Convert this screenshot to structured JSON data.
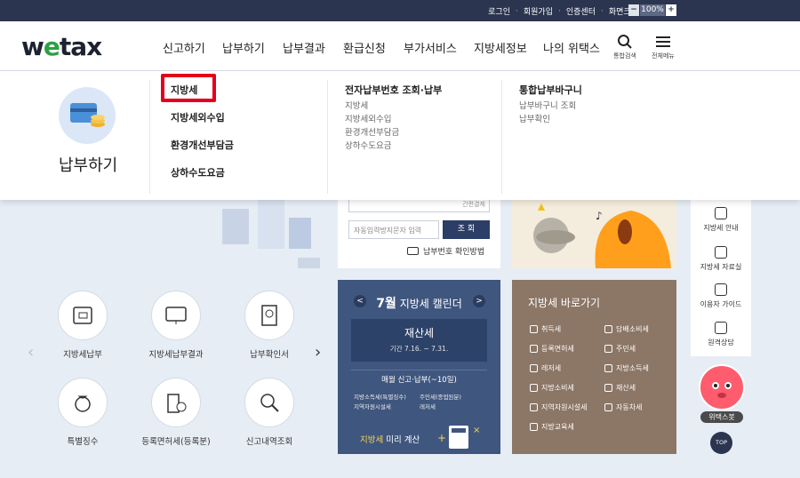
{
  "topbar": {
    "links": [
      "로그인",
      "회원가입",
      "인증센터",
      "화면크기"
    ],
    "zoom_minus": "−",
    "zoom_value": "100%",
    "zoom_plus": "+"
  },
  "header": {
    "logo": "wetax",
    "nav": [
      "신고하기",
      "납부하기",
      "납부결과",
      "환급신청",
      "부가서비스",
      "지방세정보",
      "나의 위택스"
    ],
    "search_label": "통합검색",
    "menu_label": "전체메뉴"
  },
  "mega": {
    "title": "납부하기",
    "col1": [
      "지방세",
      "지방세외수입",
      "환경개선부담금",
      "상하수도요금"
    ],
    "col2": {
      "head": "전자납부번호 조회·납부",
      "items": [
        "지방세",
        "지방세외수입",
        "환경개선부담금",
        "상하수도요금"
      ]
    },
    "col3": {
      "head": "통합납부바구니",
      "items": [
        "납부바구니 조회",
        "납부확인"
      ]
    }
  },
  "services": [
    {
      "label": "지방세납부"
    },
    {
      "label": "지방세납부결과"
    },
    {
      "label": "납부확인서"
    },
    {
      "label": "특별징수"
    },
    {
      "label": "등록면허세(등록분)"
    },
    {
      "label": "신고내역조회"
    }
  ],
  "pay": {
    "partial_btn": "간편결제",
    "placeholder": "자동입력방지문자 입력",
    "query_btn": "조 회",
    "help": "납부번호 확인방법"
  },
  "calendar": {
    "month": "7월",
    "title": "지방세 캘린더",
    "tax": "재산세",
    "period": "기간 7.16. ~ 7.31.",
    "monthly": "매월 신고·납부(~10일)",
    "items": [
      "지방소득세(특별징수)",
      "주민세(종업원분)",
      "지역자원시설세",
      "레저세"
    ],
    "precalc_hl": "지방세",
    "precalc_rest": " 미리 계산"
  },
  "shortcut": {
    "title": "지방세 바로가기",
    "items": [
      "취득세",
      "담배소비세",
      "등록면허세",
      "주민세",
      "레저세",
      "지방소득세",
      "지방소비세",
      "재산세",
      "지역자원시설세",
      "자동차세",
      "지방교육세"
    ]
  },
  "side": {
    "items": [
      "지방세 안내",
      "지방세 자료실",
      "이용자 가이드",
      "원격상담"
    ],
    "mascot": "위택스봇",
    "top": "TOP"
  },
  "colors": {
    "highlight": "#e4001c",
    "navy": "#2b3550",
    "calendar": "#3f567e",
    "shortcut": "#8c7666"
  }
}
